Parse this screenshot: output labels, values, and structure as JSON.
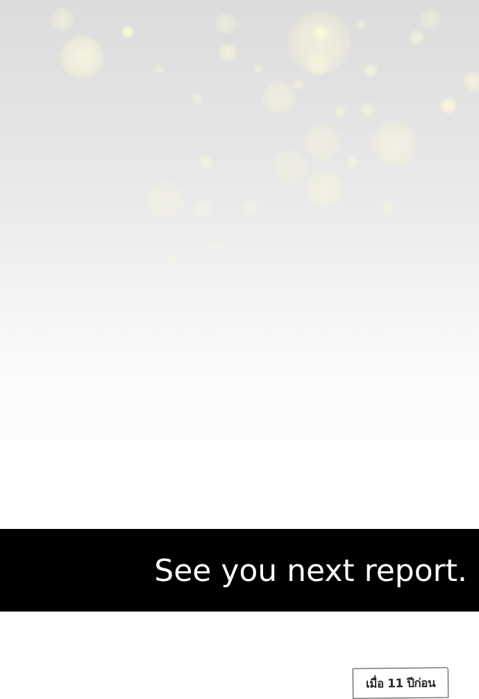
{
  "banner": {
    "text": "See you next report."
  },
  "caption": {
    "text": "เมื่อ 11 ปีก่อน"
  },
  "colors": {
    "banner_background": "#000000",
    "banner_text": "#ffffff",
    "bokeh_light": "#fff9d8"
  }
}
